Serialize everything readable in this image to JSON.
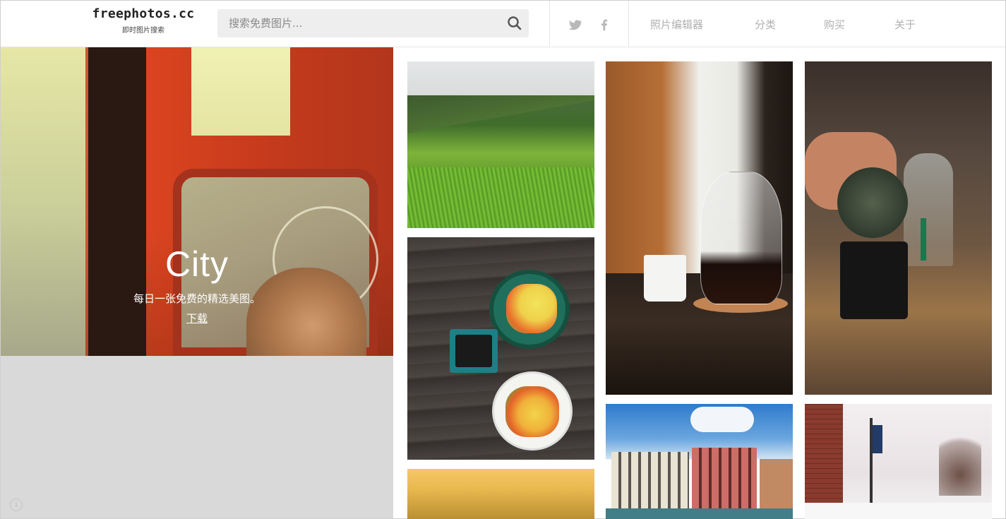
{
  "header": {
    "logo_title": "freephotos.cc",
    "logo_subtitle": "即时图片搜索",
    "search_placeholder": "搜索免费图片...",
    "social": [
      {
        "name": "twitter-icon"
      },
      {
        "name": "facebook-icon"
      }
    ],
    "nav": [
      {
        "label": "照片编辑器"
      },
      {
        "label": "分类"
      },
      {
        "label": "购买"
      },
      {
        "label": "关于"
      }
    ]
  },
  "hero": {
    "title": "City",
    "subtitle": "每日一张免费的精选美图。",
    "download_label": "下载"
  },
  "footer": {
    "info_glyph": "i"
  },
  "colors": {
    "nav_text": "#b0b0b0",
    "search_bg": "#eeeeee",
    "panel_bg": "#d9d9d9"
  }
}
